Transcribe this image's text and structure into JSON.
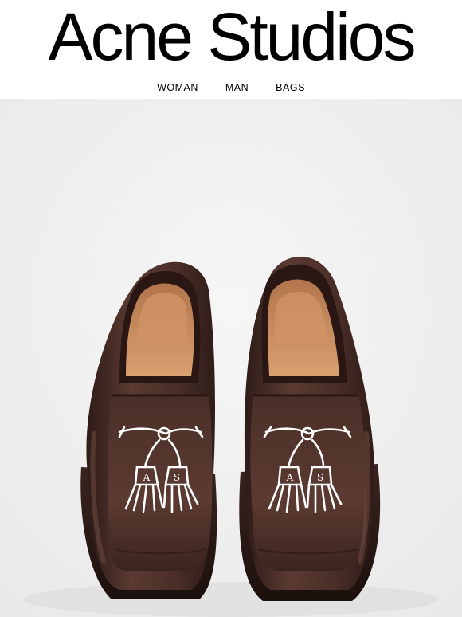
{
  "brand": {
    "name": "Acne Studios"
  },
  "nav": {
    "items": [
      {
        "label": "WOMAN"
      },
      {
        "label": "MAN"
      },
      {
        "label": "BAGS"
      }
    ]
  },
  "hero": {
    "image_alt_icon": "product-photo-loafers",
    "colors": {
      "background": "#f1f1f1",
      "leather": "#4a2e27",
      "lining": "#c98a5c",
      "tassel_print": "#ffffff"
    },
    "tassel_letters": [
      "A",
      "S"
    ]
  }
}
